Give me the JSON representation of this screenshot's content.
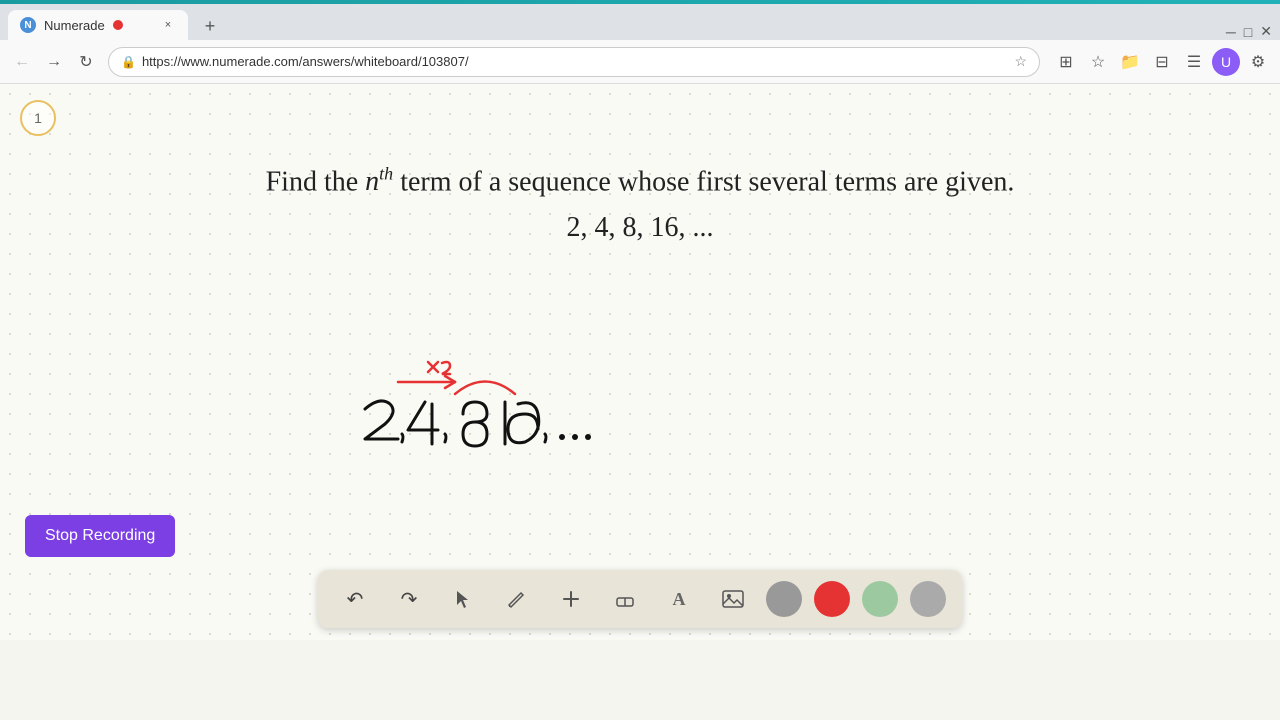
{
  "browser": {
    "top_stripe_color": "#1a9ba0",
    "tab": {
      "title": "Numerade",
      "favicon_letter": "N",
      "close_label": "×",
      "new_tab_label": "+"
    },
    "nav": {
      "back_label": "←",
      "forward_label": "→",
      "reload_label": "↻",
      "url": "https://www.numerade.com/answers/whiteboard/103807/",
      "star_icon": "★",
      "menu_icon": "⋮"
    }
  },
  "whiteboard": {
    "page_number": "1",
    "problem_line1_prefix": "Find the ",
    "problem_n": "n",
    "problem_superscript": "th",
    "problem_line1_suffix": " term of a sequence whose first several terms are given.",
    "sequence_text": "2, 4, 8, 16, ...",
    "accent_color": "#e53333"
  },
  "toolbar": {
    "undo_label": "↺",
    "redo_label": "↻",
    "select_label": "▲",
    "pencil_label": "✏",
    "add_label": "+",
    "eraser_label": "◻",
    "text_label": "A",
    "image_label": "🖼",
    "colors": [
      "#999999",
      "#e53333",
      "#9dc9a0",
      "#aaaaaa"
    ]
  },
  "stop_recording": {
    "label": "Stop Recording",
    "bg_color": "#7b3fe4",
    "text_color": "#ffffff"
  }
}
